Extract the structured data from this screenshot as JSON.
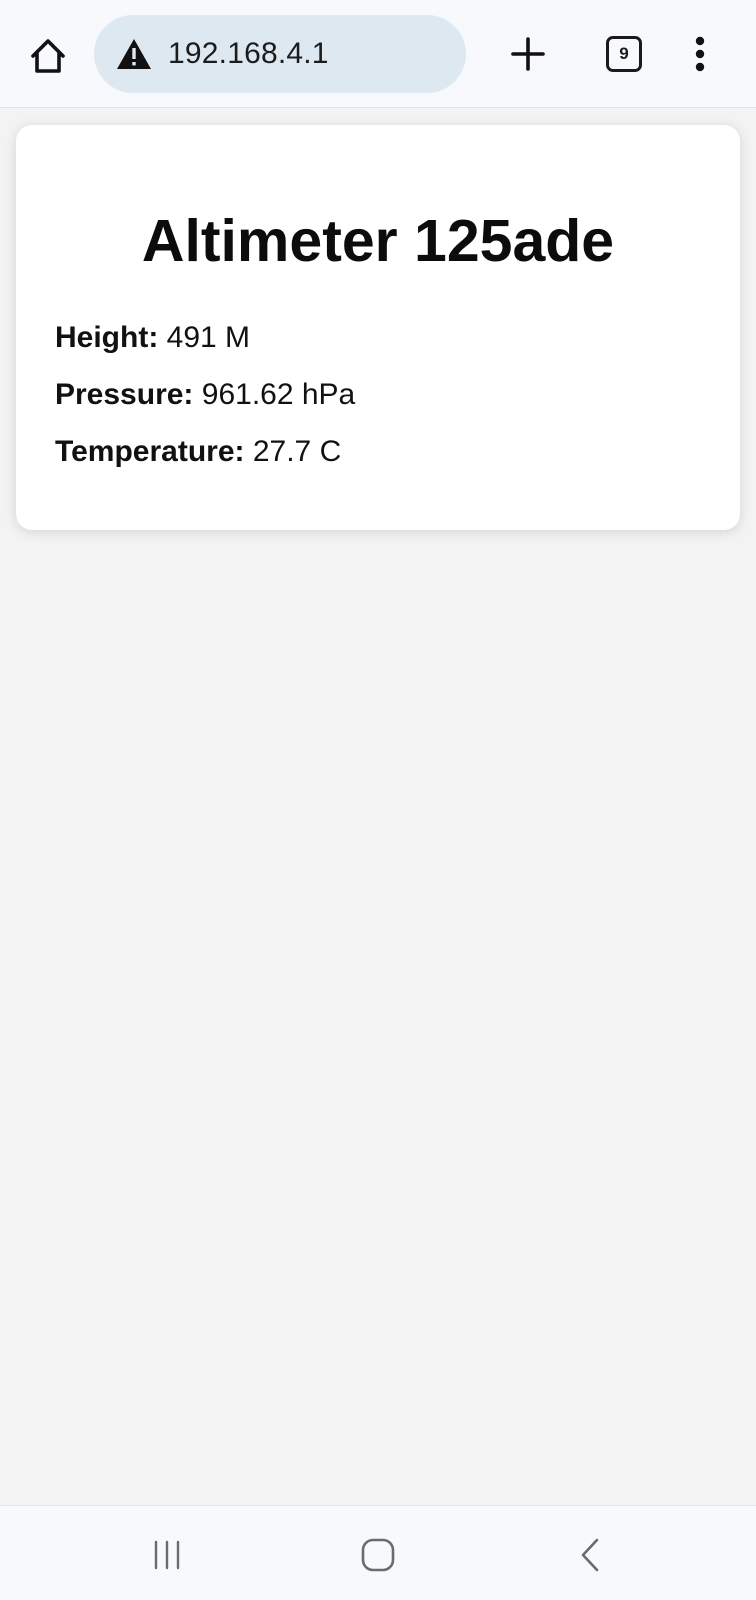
{
  "browser": {
    "url": "192.168.4.1",
    "tab_count": "9",
    "icons": {
      "home": "home-icon",
      "security": "warning-icon",
      "new_tab": "plus-icon",
      "tabs": "tab-switcher-icon",
      "menu": "more-vertical-icon"
    }
  },
  "page": {
    "title": "Altimeter 125ade",
    "readings": [
      {
        "label": "Height:",
        "value": "491 M"
      },
      {
        "label": "Pressure:",
        "value": "961.62 hPa"
      },
      {
        "label": "Temperature:",
        "value": "27.7 C"
      }
    ]
  },
  "system_nav": {
    "icons": {
      "recents": "recents-icon",
      "home": "circle-home-icon",
      "back": "chevron-left-icon"
    }
  },
  "colors": {
    "toolbar_bg": "#f7f9fc",
    "url_bar_bg": "#dde8f1",
    "page_bg": "#f3f3f3",
    "card_bg": "#ffffff"
  }
}
